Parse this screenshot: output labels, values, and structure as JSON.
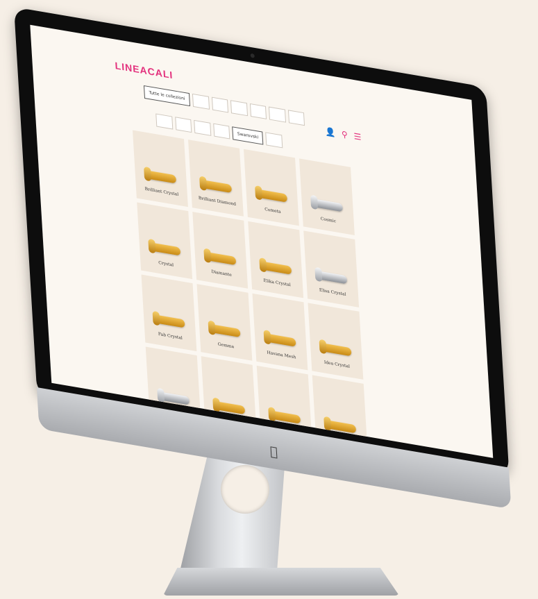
{
  "logo": "LINEACALI",
  "header_icons": [
    "user-icon",
    "search-icon",
    "menu-icon"
  ],
  "filters_row1": [
    {
      "label": "Tutte le collezioni",
      "active": true
    },
    {
      "label": "",
      "active": false
    },
    {
      "label": "",
      "active": false
    },
    {
      "label": "",
      "active": false
    },
    {
      "label": "",
      "active": false
    },
    {
      "label": "",
      "active": false
    },
    {
      "label": "",
      "active": false
    }
  ],
  "filters_row2": [
    {
      "label": "",
      "active": false
    },
    {
      "label": "",
      "active": false
    },
    {
      "label": "",
      "active": false
    },
    {
      "label": "",
      "active": false
    },
    {
      "label": "Swarovski",
      "active": true
    },
    {
      "label": "",
      "active": false
    }
  ],
  "products": [
    {
      "name": "Brilliant Crystal",
      "finish": "gold"
    },
    {
      "name": "Brilliant Diamond",
      "finish": "gold"
    },
    {
      "name": "Cometa",
      "finish": "gold"
    },
    {
      "name": "Cosmic",
      "finish": "chrome"
    },
    {
      "name": "Crystal",
      "finish": "gold"
    },
    {
      "name": "Diamante",
      "finish": "gold"
    },
    {
      "name": "Elika Crystal",
      "finish": "gold"
    },
    {
      "name": "Elisa Crystal",
      "finish": "chrome"
    },
    {
      "name": "Fab Crystal",
      "finish": "gold"
    },
    {
      "name": "Gemma",
      "finish": "gold"
    },
    {
      "name": "Havana Mesh",
      "finish": "gold"
    },
    {
      "name": "Idea Crystal",
      "finish": "gold"
    },
    {
      "name": "",
      "finish": "chrome"
    },
    {
      "name": "",
      "finish": "gold"
    },
    {
      "name": "",
      "finish": "gold"
    },
    {
      "name": "",
      "finish": "gold"
    }
  ],
  "colors": {
    "brand": "#e3317d",
    "card_bg": "#f1e7da",
    "page_bg": "#f6efe6"
  }
}
